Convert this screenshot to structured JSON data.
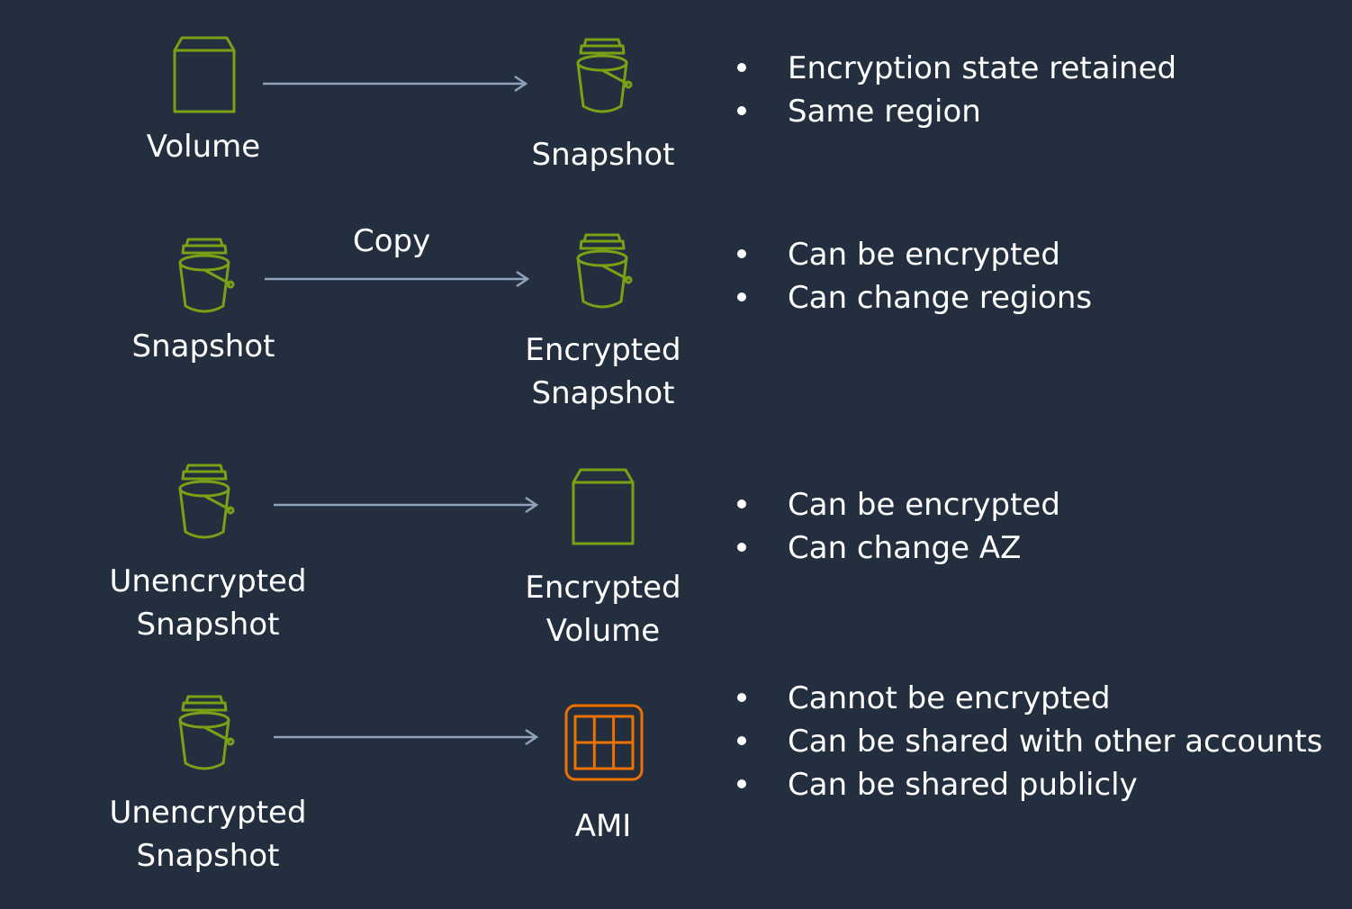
{
  "colors": {
    "background": "#232f3e",
    "storage_icon": "#7aa116",
    "compute_icon": "#ed7100",
    "arrow": "#8fa3bd",
    "text": "#ffffff"
  },
  "rows": [
    {
      "source": {
        "icon": "volume-icon",
        "label_lines": [
          "Volume"
        ]
      },
      "arrow_label": "",
      "target": {
        "icon": "snapshot-icon",
        "label_lines": [
          "Snapshot"
        ]
      },
      "bullets": [
        "Encryption state retained",
        "Same region"
      ]
    },
    {
      "source": {
        "icon": "snapshot-icon",
        "label_lines": [
          "Snapshot"
        ]
      },
      "arrow_label": "Copy",
      "target": {
        "icon": "snapshot-icon",
        "label_lines": [
          "Encrypted",
          "Snapshot"
        ]
      },
      "bullets": [
        "Can be encrypted",
        "Can change regions"
      ]
    },
    {
      "source": {
        "icon": "snapshot-icon",
        "label_lines": [
          "Unencrypted",
          "Snapshot"
        ]
      },
      "arrow_label": "",
      "target": {
        "icon": "volume-icon",
        "label_lines": [
          "Encrypted",
          "Volume"
        ]
      },
      "bullets": [
        "Can be encrypted",
        "Can change AZ"
      ]
    },
    {
      "source": {
        "icon": "snapshot-icon",
        "label_lines": [
          "Unencrypted",
          "Snapshot"
        ]
      },
      "arrow_label": "",
      "target": {
        "icon": "ami-icon",
        "label_lines": [
          "AMI"
        ]
      },
      "bullets": [
        "Cannot be encrypted",
        "Can be shared with other accounts",
        "Can be shared publicly"
      ]
    }
  ]
}
